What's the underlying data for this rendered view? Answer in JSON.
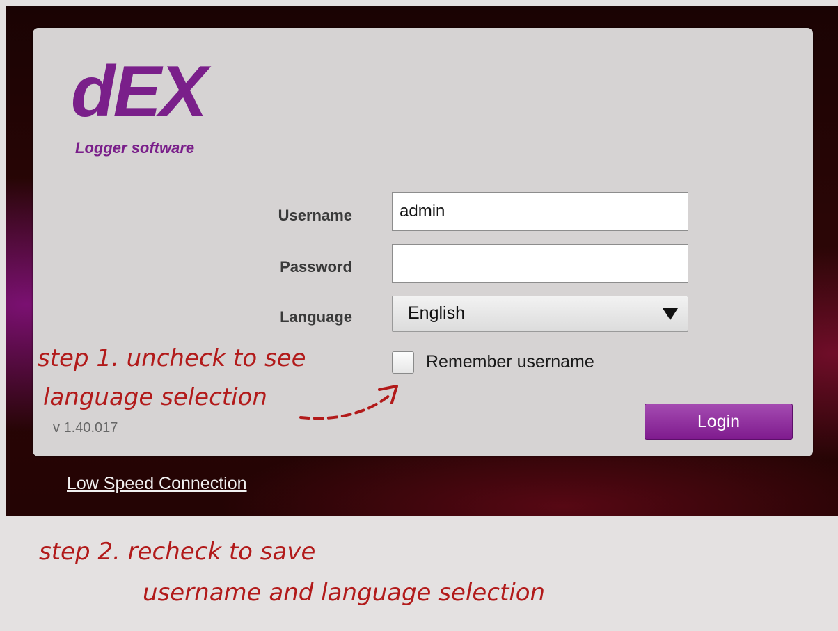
{
  "logo": {
    "title": "dEX",
    "subtitle": "Logger software"
  },
  "form": {
    "username_label": "Username",
    "username_value": "admin",
    "password_label": "Password",
    "password_value": "",
    "language_label": "Language",
    "language_selected": "English",
    "remember_label": "Remember username",
    "remember_checked": false,
    "login_label": "Login"
  },
  "version": "v 1.40.017",
  "low_speed_link": "Low Speed Connection",
  "annotations": {
    "step1_line1": "step 1. uncheck to see",
    "step1_line2": "language selection",
    "step2_line1": "step 2. recheck to save",
    "step2_line2": "username and language selection"
  },
  "colors": {
    "brand_purple": "#7a1f8a",
    "annotation_red": "#b21a1a",
    "panel_gray": "#d6d3d3"
  }
}
